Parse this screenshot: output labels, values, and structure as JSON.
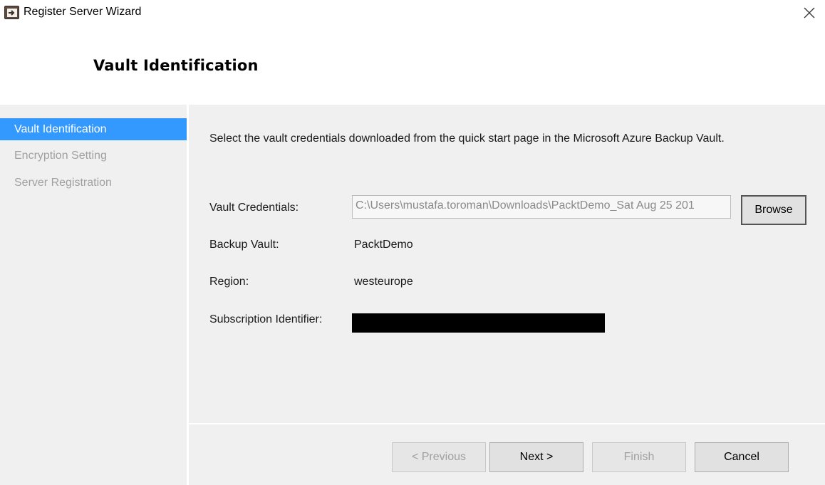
{
  "window": {
    "title": "Register Server Wizard",
    "icon": "wizard-app-icon",
    "close_icon": "close-icon"
  },
  "header": {
    "heading": "Vault Identification"
  },
  "sidebar": {
    "items": [
      {
        "label": "Vault Identification",
        "active": true
      },
      {
        "label": "Encryption Setting",
        "active": false
      },
      {
        "label": "Server Registration",
        "active": false
      }
    ],
    "active_color": "#3399ff"
  },
  "main": {
    "intro": "Select the vault credentials downloaded from the quick start page in the Microsoft Azure Backup Vault.",
    "fields": {
      "vault_credentials_label": "Vault Credentials:",
      "vault_credentials_value": "C:\\Users\\mustafa.toroman\\Downloads\\PacktDemo_Sat Aug 25 201",
      "browse_label": "Browse",
      "backup_vault_label": "Backup Vault:",
      "backup_vault_value": "PacktDemo",
      "region_label": "Region:",
      "region_value": "westeurope",
      "subscription_label": "Subscription Identifier:"
    }
  },
  "footer": {
    "previous_label": "< Previous",
    "next_label": "Next >",
    "finish_label": "Finish",
    "cancel_label": "Cancel"
  }
}
